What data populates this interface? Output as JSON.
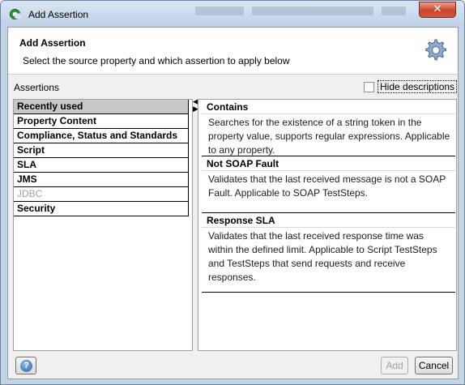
{
  "window": {
    "title": "Add Assertion",
    "close_glyph": "✕"
  },
  "header": {
    "title": "Add Assertion",
    "subtitle": "Select the source property and which assertion to apply below",
    "icon": "gear-icon"
  },
  "assertions_label": "Assertions",
  "hide_descriptions": {
    "label": "Hide descriptions",
    "checked": false
  },
  "categories": [
    {
      "label": "Recently used",
      "selected": true,
      "enabled": true
    },
    {
      "label": "Property Content",
      "selected": false,
      "enabled": true
    },
    {
      "label": "Compliance, Status and Standards",
      "selected": false,
      "enabled": true
    },
    {
      "label": "Script",
      "selected": false,
      "enabled": true
    },
    {
      "label": "SLA",
      "selected": false,
      "enabled": true
    },
    {
      "label": "JMS",
      "selected": false,
      "enabled": true
    },
    {
      "label": "JDBC",
      "selected": false,
      "enabled": false
    },
    {
      "label": "Security",
      "selected": false,
      "enabled": true
    }
  ],
  "assertions": [
    {
      "name": "Contains",
      "description": "Searches for the existence of a string token in the property value, supports regular expressions. Applicable to any property."
    },
    {
      "name": "Not SOAP Fault",
      "description": "Validates that the last received message is not a SOAP Fault. Applicable to SOAP TestSteps."
    },
    {
      "name": "Response SLA",
      "description": "Validates that the last received response time was within the defined limit. Applicable to Script TestSteps and TestSteps that send requests and receive responses."
    }
  ],
  "footer": {
    "help_glyph": "?",
    "add_label": "Add",
    "add_enabled": false,
    "cancel_label": "Cancel"
  },
  "colors": {
    "selected_bg": "#c8c8c8",
    "frame": "#c4d3e6",
    "close": "#c8452c"
  }
}
